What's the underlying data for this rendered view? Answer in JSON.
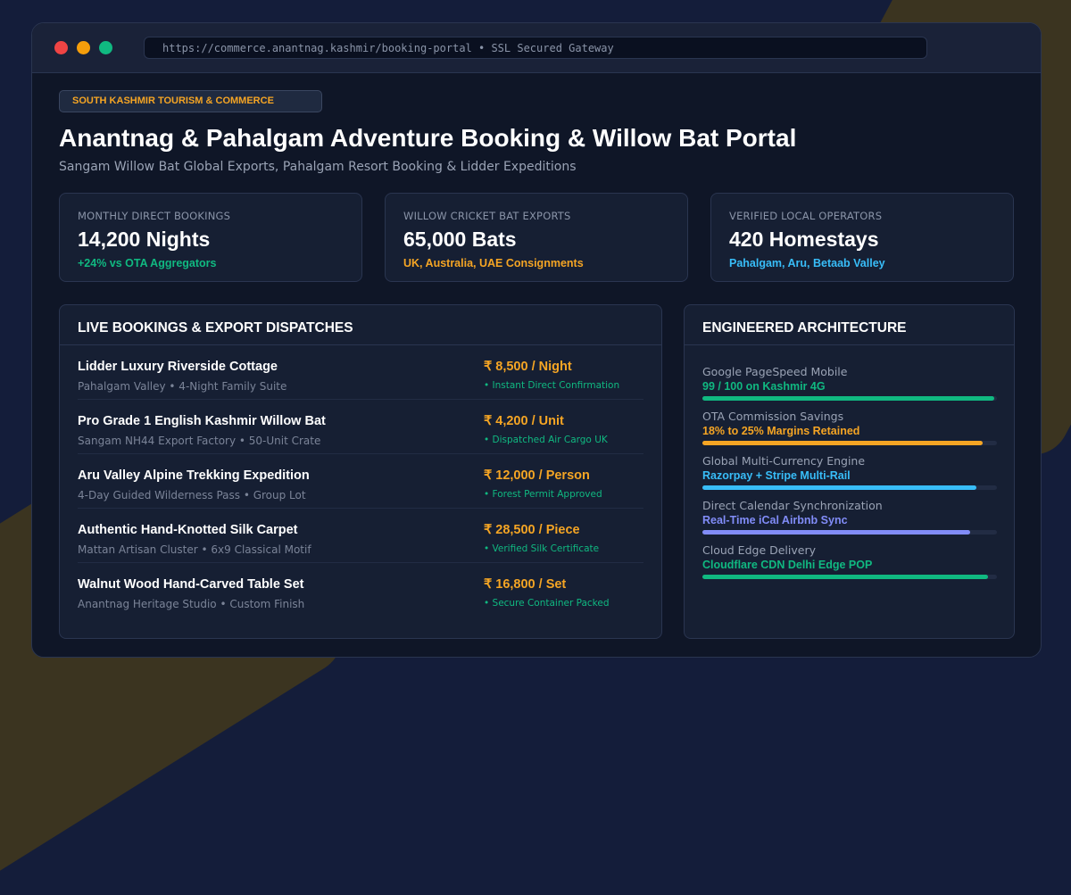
{
  "browser": {
    "url": "https://commerce.anantnag.kashmir/booking-portal • SSL Secured Gateway"
  },
  "header": {
    "badge": "SOUTH KASHMIR TOURISM & COMMERCE",
    "title": "Anantnag & Pahalgam Adventure Booking & Willow Bat Portal",
    "subtitle": "Sangam Willow Bat Global Exports, Pahalgam Resort Booking & Lidder Expeditions"
  },
  "stats": [
    {
      "label": "MONTHLY DIRECT BOOKINGS",
      "value": "14,200 Nights",
      "note": "+24% vs OTA Aggregators",
      "color": "#10b981"
    },
    {
      "label": "WILLOW CRICKET BAT EXPORTS",
      "value": "65,000 Bats",
      "note": "UK, Australia, UAE Consignments",
      "color": "#f5a524"
    },
    {
      "label": "VERIFIED LOCAL OPERATORS",
      "value": "420 Homestays",
      "note": "Pahalgam, Aru, Betaab Valley",
      "color": "#38bdf8"
    }
  ],
  "dispatches": {
    "title": "LIVE BOOKINGS & EXPORT DISPATCHES",
    "rows": [
      {
        "name": "Lidder Luxury Riverside Cottage",
        "sub": "Pahalgam Valley • 4-Night Family Suite",
        "price": "₹ 8,500 / Night",
        "status": "• Instant Direct Confirmation"
      },
      {
        "name": "Pro Grade 1 English Kashmir Willow Bat",
        "sub": "Sangam NH44 Export Factory • 50-Unit Crate",
        "price": "₹ 4,200 / Unit",
        "status": "• Dispatched Air Cargo UK"
      },
      {
        "name": "Aru Valley Alpine Trekking Expedition",
        "sub": "4-Day Guided Wilderness Pass • Group Lot",
        "price": "₹ 12,000 / Person",
        "status": "• Forest Permit Approved"
      },
      {
        "name": "Authentic Hand-Knotted Silk Carpet",
        "sub": "Mattan Artisan Cluster • 6x9 Classical Motif",
        "price": "₹ 28,500 / Piece",
        "status": "• Verified Silk Certificate"
      },
      {
        "name": "Walnut Wood Hand-Carved Table Set",
        "sub": "Anantnag Heritage Studio • Custom Finish",
        "price": "₹ 16,800 / Set",
        "status": "• Secure Container Packed"
      }
    ]
  },
  "architecture": {
    "title": "ENGINEERED ARCHITECTURE",
    "metrics": [
      {
        "label": "Google PageSpeed Mobile",
        "value": "99 / 100 on Kashmir 4G",
        "level": 0.99,
        "color": "#10b981"
      },
      {
        "label": "OTA Commission Savings",
        "value": "18% to 25% Margins Retained",
        "level": 0.95,
        "color": "#f5a524"
      },
      {
        "label": "Global Multi-Currency Engine",
        "value": "Razorpay + Stripe Multi-Rail",
        "level": 0.93,
        "color": "#38bdf8"
      },
      {
        "label": "Direct Calendar Synchronization",
        "value": "Real-Time iCal Airbnb Sync",
        "level": 0.91,
        "color": "#818cf8"
      },
      {
        "label": "Cloud Edge Delivery",
        "value": "Cloudflare CDN Delhi Edge POP",
        "level": 0.97,
        "color": "#10b981"
      }
    ]
  }
}
